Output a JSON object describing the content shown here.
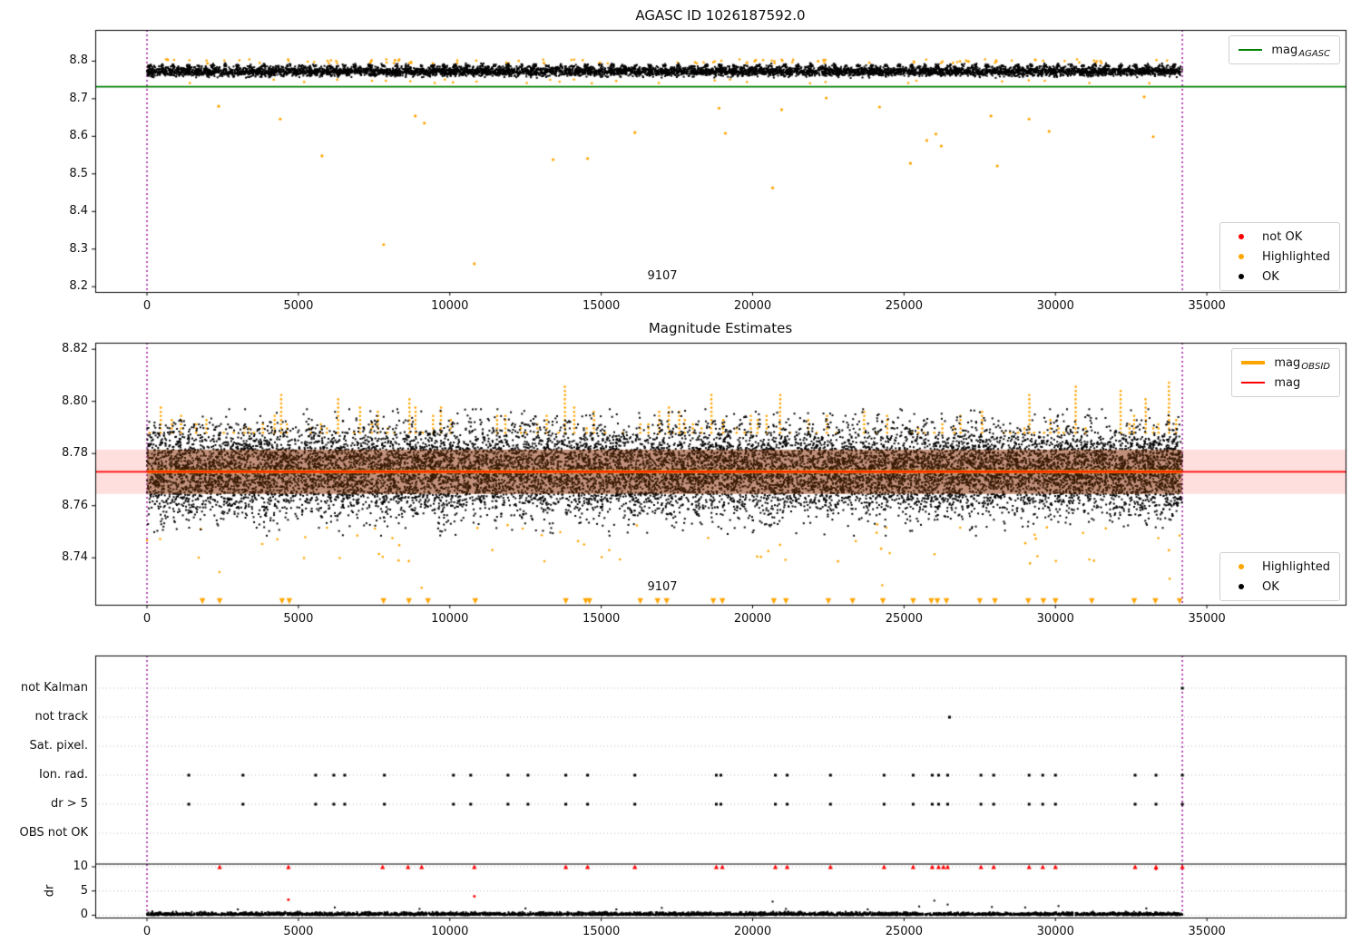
{
  "colors": {
    "ok": "#000000",
    "highlighted": "#ffa500",
    "not_ok": "#ff0000",
    "mag_agasc_line": "#008000",
    "mag_line": "#ff0000",
    "mag_obsid_line": "#ffa500",
    "mag_err_band": "rgba(255,0,0,0.13)",
    "dense_core_tint": "rgba(120,50,5,0.45)",
    "obs_boundary_line": "#990099",
    "grid": "#bbbbbb",
    "divider": "#000000"
  },
  "chart_data": [
    {
      "id": "mag-overview",
      "type": "scatter",
      "title": "AGASC ID 1026187592.0",
      "xlim": [
        -1708,
        39580
      ],
      "ylim": [
        8.186,
        8.883
      ],
      "xticks": [
        0,
        5000,
        10000,
        15000,
        20000,
        25000,
        30000,
        35000
      ],
      "yticks": [
        {
          "v": 8.8,
          "label": "8.8"
        },
        {
          "v": 8.7,
          "label": "8.7"
        },
        {
          "v": 8.6,
          "label": "8.6"
        },
        {
          "v": 8.5,
          "label": "8.5"
        },
        {
          "v": 8.4,
          "label": "8.4"
        },
        {
          "v": 8.3,
          "label": "8.3"
        },
        {
          "v": 8.2,
          "label": "8.2"
        }
      ],
      "mag_agasc": 8.732,
      "obs_range": [
        0,
        34190
      ],
      "annotation": {
        "text": "9107",
        "x": 17000,
        "y": 8.225
      },
      "legend_line": {
        "main": "mag",
        "sub": "AGASC"
      },
      "legend_markers": [
        {
          "label": "not OK",
          "color": "#ff0000"
        },
        {
          "label": "Highlighted",
          "color": "#ffa500"
        },
        {
          "label": "OK",
          "color": "#000000"
        }
      ],
      "ok_band": {
        "center": 8.7725,
        "halfwidth": 0.0185,
        "count": 6500,
        "clip": [
          8.754,
          8.7915
        ]
      },
      "spike_columns": {
        "spacing": 350,
        "jitter": 150,
        "points": 10,
        "top": 8.795
      },
      "highlighted_above": {
        "ymin": 8.7935,
        "ymax": 8.805
      },
      "highlighted_below": {
        "ymin": 8.741,
        "ymax": 8.751
      },
      "highlighted_outliers": [
        [
          2365,
          8.68
        ],
        [
          4400,
          8.646
        ],
        [
          5780,
          8.548
        ],
        [
          7815,
          8.312
        ],
        [
          8860,
          8.654
        ],
        [
          9160,
          8.635
        ],
        [
          10810,
          8.261
        ],
        [
          13410,
          8.538
        ],
        [
          14550,
          8.541
        ],
        [
          16110,
          8.61
        ],
        [
          18890,
          8.675
        ],
        [
          19100,
          8.608
        ],
        [
          20660,
          8.463
        ],
        [
          20960,
          8.671
        ],
        [
          22430,
          8.702
        ],
        [
          24190,
          8.678
        ],
        [
          25210,
          8.528
        ],
        [
          25750,
          8.589
        ],
        [
          26050,
          8.606
        ],
        [
          26230,
          8.574
        ],
        [
          27870,
          8.654
        ],
        [
          28080,
          8.521
        ],
        [
          29130,
          8.646
        ],
        [
          29790,
          8.613
        ],
        [
          32930,
          8.705
        ],
        [
          33230,
          8.599
        ]
      ]
    },
    {
      "id": "mag-estimates",
      "type": "scatter",
      "title": "Magnitude Estimates",
      "xlim": [
        -1708,
        39580
      ],
      "ylim": [
        8.722,
        8.8225
      ],
      "xticks": [
        0,
        5000,
        10000,
        15000,
        20000,
        25000,
        30000,
        35000
      ],
      "yticks": [
        {
          "v": 8.82,
          "label": "8.82"
        },
        {
          "v": 8.8,
          "label": "8.80"
        },
        {
          "v": 8.78,
          "label": "8.78"
        },
        {
          "v": 8.76,
          "label": "8.76"
        },
        {
          "v": 8.74,
          "label": "8.74"
        }
      ],
      "mag": 8.773,
      "mag_err_band": [
        8.7645,
        8.7815
      ],
      "obs_range": [
        0,
        34190
      ],
      "annotation": {
        "text": "9107",
        "x": 17000,
        "y": 8.7295
      },
      "legend_lines": [
        {
          "main": "mag",
          "sub": "OBSID",
          "color": "#ffa500"
        },
        {
          "main": "mag",
          "sub": "",
          "color": "#ff0000"
        }
      ],
      "legend_markers": [
        {
          "label": "Highlighted",
          "color": "#ffa500"
        },
        {
          "label": "OK",
          "color": "#000000"
        }
      ],
      "ok_band": {
        "center": 8.7735,
        "sigma": 0.0085,
        "count": 14500,
        "clip": [
          8.7485,
          8.797
        ]
      },
      "highlighted_columns": {
        "base": 8.788,
        "step": 0.0016,
        "max": 8.8165
      },
      "highlighted_low_scatter": {
        "count": 60,
        "ymin": 8.7375,
        "ymax": 8.753
      },
      "highlighted_low_extra": [
        [
          9070,
          8.7285
        ],
        [
          2395,
          8.7345
        ],
        [
          24280,
          8.7295
        ],
        [
          33770,
          8.732
        ]
      ],
      "clipped_low_x": [
        1830,
        2400,
        4460,
        4700,
        7810,
        8650,
        9280,
        10840,
        13830,
        14490,
        14610,
        16290,
        16860,
        17160,
        18700,
        19000,
        20700,
        21100,
        22500,
        23300,
        24300,
        25300,
        25900,
        26100,
        26400,
        27500,
        28000,
        29100,
        29600,
        30000,
        31200,
        32600,
        33300,
        34100
      ]
    },
    {
      "id": "quality-flags",
      "type": "scatter",
      "xlim": [
        -1708,
        39580
      ],
      "xticks": [
        0,
        5000,
        10000,
        15000,
        20000,
        25000,
        30000,
        35000
      ],
      "flag_rows": [
        "not Kalman",
        "not track",
        "Sat. pixel.",
        "Ion. rad.",
        "dr > 5",
        "OBS not OK"
      ],
      "dr_ticks": [
        10,
        5,
        0
      ],
      "dr_label": "dr",
      "obs_range": [
        0,
        34190
      ],
      "not_kalman_x": [
        34190
      ],
      "not_track_x": [
        26500
      ],
      "sat_pixel_x": [],
      "ion_rad_x": [
        1380,
        3170,
        5570,
        6170,
        6530,
        7840,
        10120,
        10690,
        11920,
        12580,
        13830,
        14550,
        16110,
        18800,
        18950,
        20750,
        21140,
        22570,
        24340,
        25300,
        25930,
        26140,
        26440,
        27540,
        27960,
        29130,
        29580,
        30000,
        32630,
        33320,
        34190
      ],
      "dr_gt5_x": [
        1380,
        3170,
        5570,
        6170,
        6530,
        7840,
        10120,
        10690,
        11920,
        12580,
        13830,
        14550,
        16110,
        18800,
        18950,
        20750,
        21140,
        22570,
        24340,
        25300,
        25930,
        26140,
        26440,
        27540,
        27960,
        29130,
        29580,
        30000,
        32630,
        33320,
        34190
      ],
      "obs_not_ok_x": [],
      "dr10_clipped_x": [
        2400,
        4670,
        7780,
        8620,
        9070,
        10810,
        13830,
        14550,
        16110,
        18800,
        19000,
        20750,
        21140,
        22570,
        24340,
        25300,
        25930,
        26140,
        26300,
        26440,
        27540,
        27960,
        29130,
        29580,
        30000,
        32630,
        33320,
        34190
      ],
      "dr_red_points": [
        [
          4670,
          3.2
        ],
        [
          10810,
          3.9
        ],
        [
          33320,
          9.6
        ]
      ],
      "dr_band": {
        "count": 3800,
        "scale": 0.55,
        "clip": 1.1
      },
      "dr_black_extra": [
        [
          3000,
          1.2
        ],
        [
          6200,
          1.6
        ],
        [
          9000,
          1.3
        ],
        [
          12500,
          1.4
        ],
        [
          15500,
          1.2
        ],
        [
          17000,
          1.5
        ],
        [
          20660,
          2.8
        ],
        [
          21100,
          1.3
        ],
        [
          23800,
          1.2
        ],
        [
          25500,
          1.8
        ],
        [
          26000,
          3.0
        ],
        [
          26440,
          2.2
        ],
        [
          27900,
          1.7
        ],
        [
          29000,
          1.6
        ],
        [
          30100,
          1.9
        ],
        [
          33000,
          1.4
        ]
      ]
    }
  ]
}
